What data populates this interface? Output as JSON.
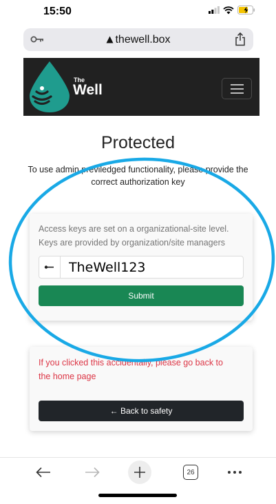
{
  "status": {
    "time": "15:50",
    "battery_color": "#f5c400"
  },
  "browser": {
    "url": "thewell.box",
    "tabs_count": "26"
  },
  "navbar": {
    "brand_small": "The",
    "brand_large": "Well",
    "logo_color": "#1f9c8e"
  },
  "page": {
    "title": "Protected",
    "subtitle_line1": "To use admin previledged functionality, please provide the",
    "subtitle_line2": "correct authorization key"
  },
  "auth_card": {
    "info_line1": "Access keys are set on a organizational-site level.",
    "info_line2": "Keys are provided by organization/site managers",
    "key_value": "TheWell123",
    "submit_label": "Submit",
    "submit_color": "#198754"
  },
  "info_card": {
    "message_line1": "If you clicked this accidentally, please go back to",
    "message_line2": "the home page",
    "back_label": "← Back to safety"
  },
  "annotation": {
    "color": "#19a9e6"
  },
  "icons": [
    "key-icon",
    "lock-icon",
    "share-icon",
    "menu-icon",
    "back-arrow-icon",
    "forward-arrow-icon",
    "new-tab-icon",
    "tabs-icon",
    "more-icon"
  ]
}
